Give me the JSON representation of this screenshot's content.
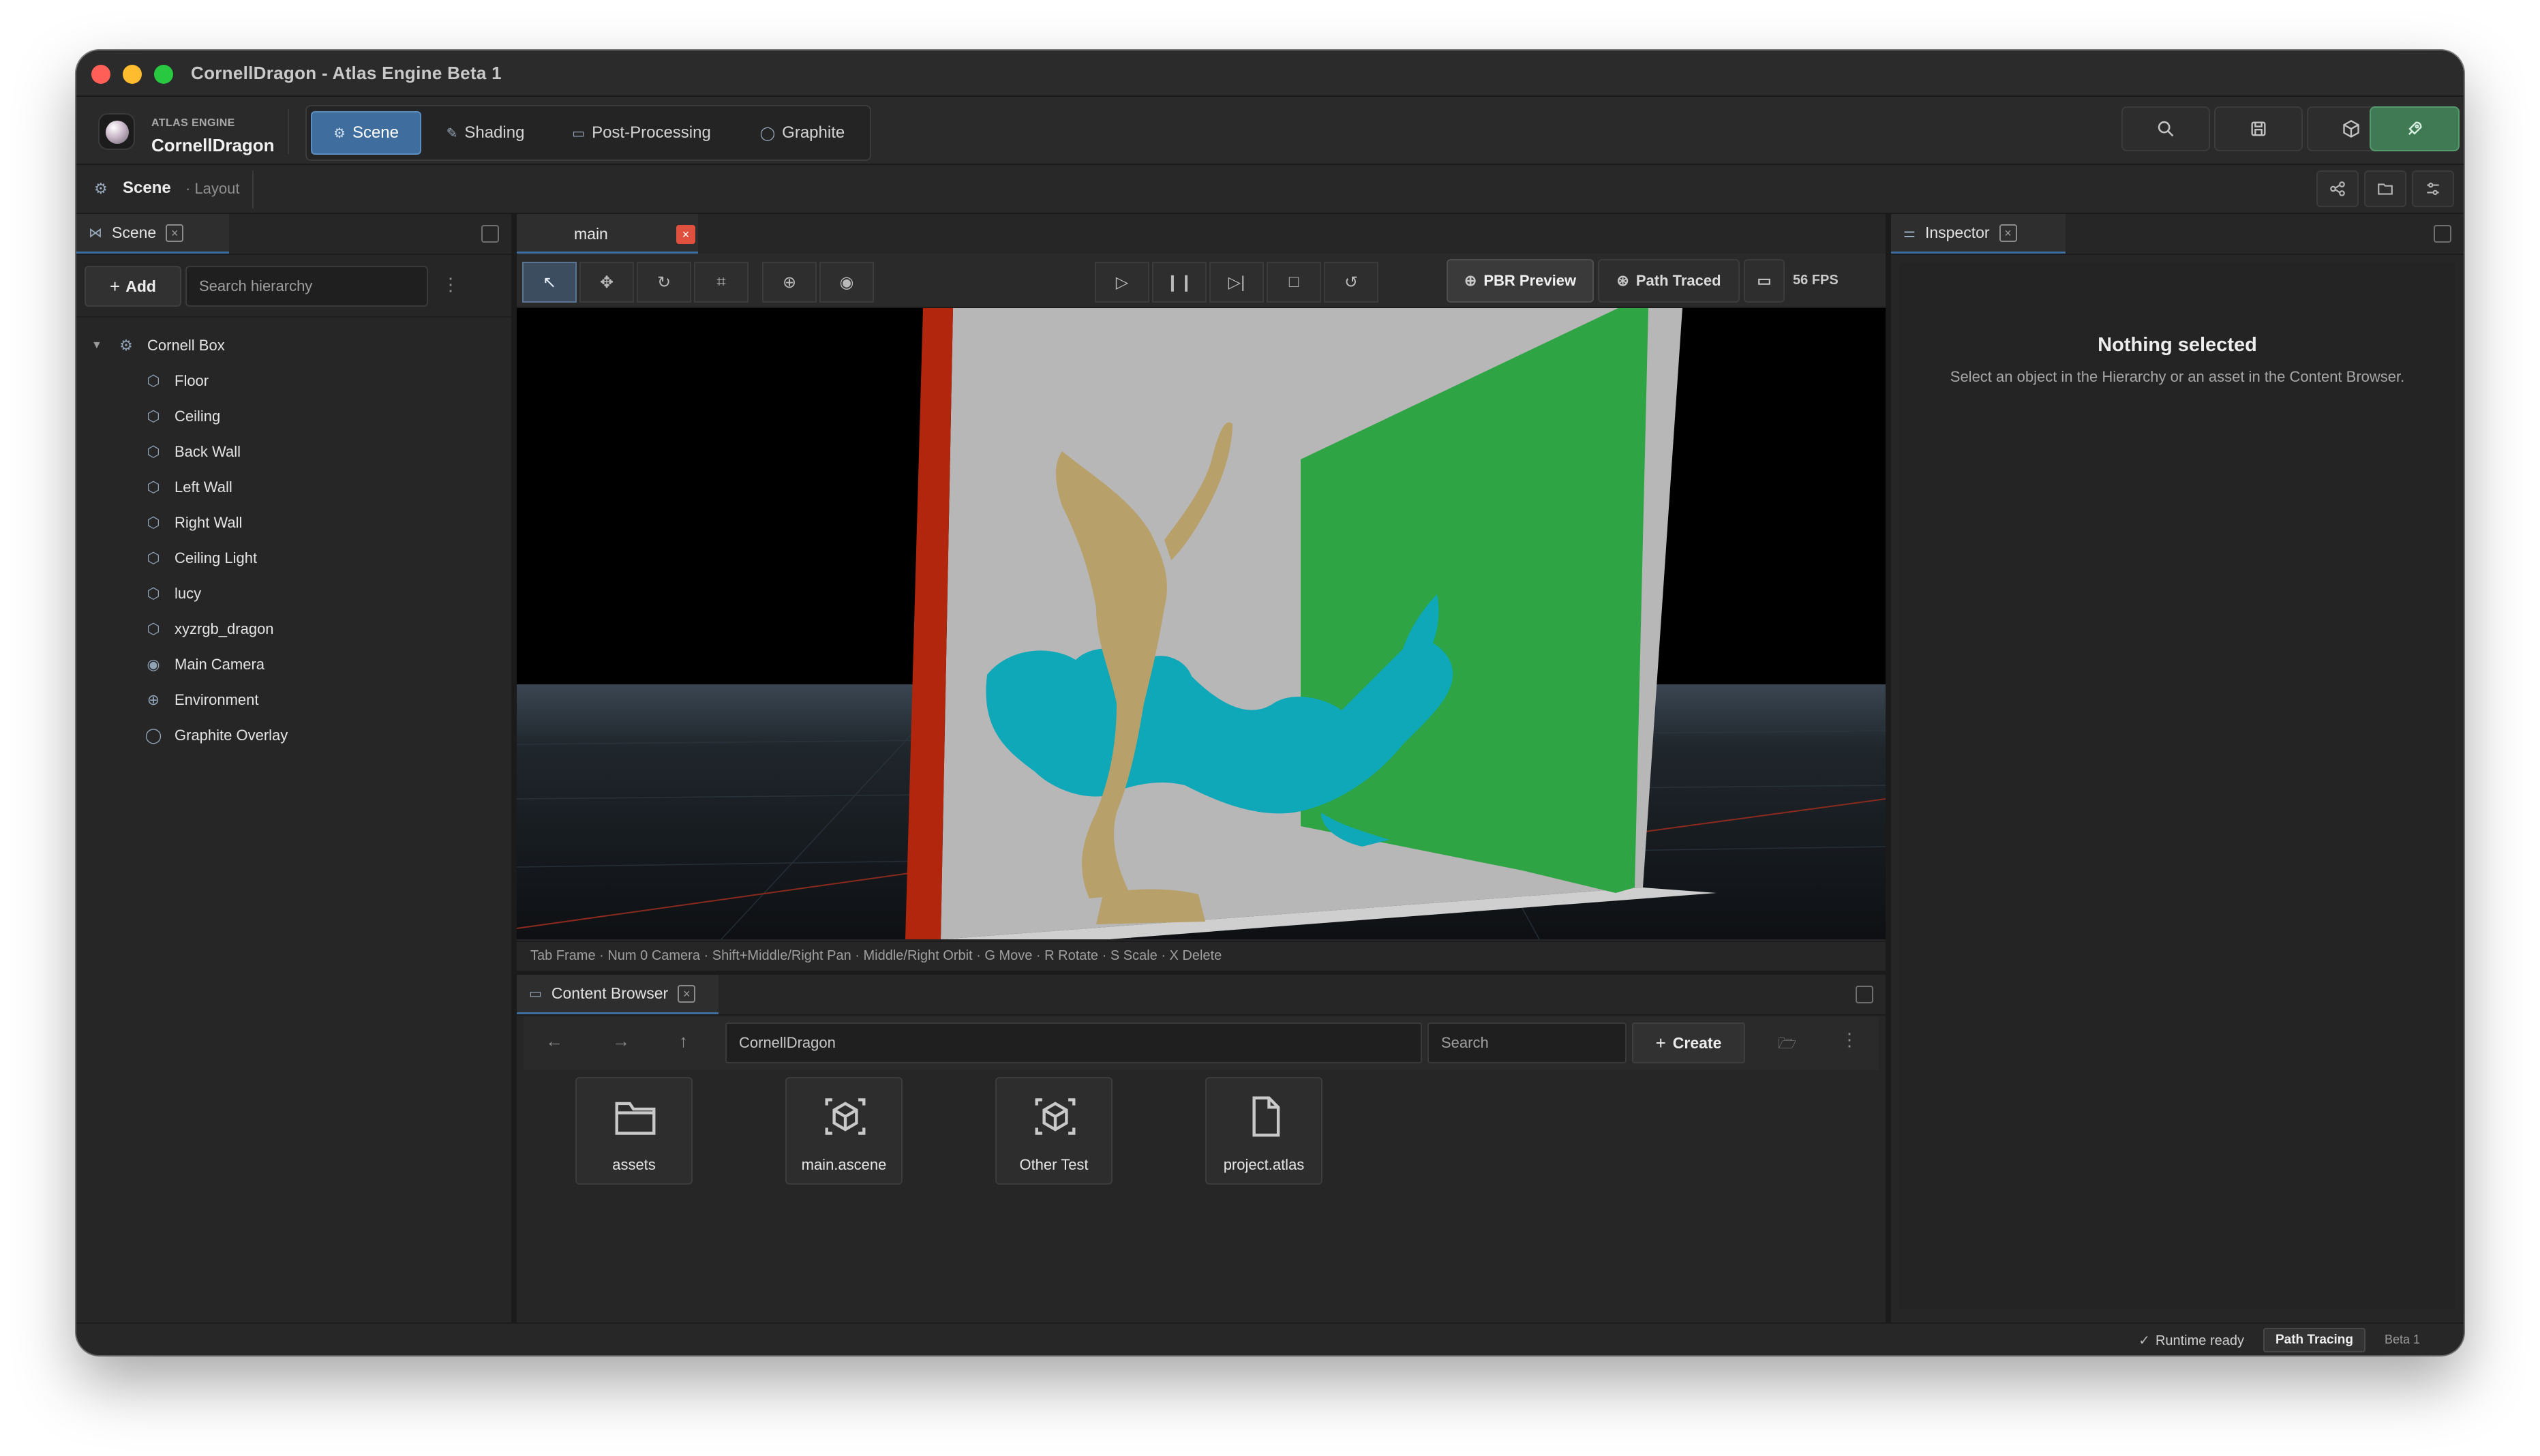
{
  "window": {
    "title": "CornellDragon - Atlas Engine Beta 1",
    "traffic_colors": [
      "#ff5f57",
      "#febc2e",
      "#28c840"
    ]
  },
  "brand": {
    "small": "ATLAS ENGINE",
    "project": "CornellDragon"
  },
  "modes": [
    {
      "label": "Scene",
      "icon": "scene-icon",
      "active": true
    },
    {
      "label": "Shading",
      "icon": "brush-icon"
    },
    {
      "label": "Post-Processing",
      "icon": "image-icon"
    },
    {
      "label": "Graphite",
      "icon": "speech-bubble-icon"
    }
  ],
  "toolbar_right": [
    "search-icon",
    "save-icon",
    "package-icon",
    "rocket-icon"
  ],
  "subbar": {
    "title": "Scene",
    "layout": "· Layout"
  },
  "hierarchy": {
    "tab": "Scene",
    "add_label": "Add",
    "search_placeholder": "Search hierarchy",
    "root": "Cornell Box",
    "items": [
      {
        "label": "Floor",
        "icon": "cube-icon"
      },
      {
        "label": "Ceiling",
        "icon": "cube-icon"
      },
      {
        "label": "Back Wall",
        "icon": "cube-icon"
      },
      {
        "label": "Left Wall",
        "icon": "cube-icon"
      },
      {
        "label": "Right Wall",
        "icon": "cube-icon"
      },
      {
        "label": "Ceiling Light",
        "icon": "cube-icon"
      },
      {
        "label": "lucy",
        "icon": "cube-icon"
      },
      {
        "label": "xyzrgb_dragon",
        "icon": "cube-icon"
      },
      {
        "label": "Main Camera",
        "icon": "camera-icon"
      },
      {
        "label": "Environment",
        "icon": "globe-icon"
      },
      {
        "label": "Graphite Overlay",
        "icon": "speech-bubble-icon"
      }
    ]
  },
  "viewport": {
    "tab": "main",
    "pbr_label": "PBR Preview",
    "path_label": "Path Traced",
    "fps": "56 FPS",
    "hint": "Tab Frame · Num 0 Camera · Shift+Middle/Right Pan · Middle/Right Orbit · G Move · R Rotate · S Scale · X Delete"
  },
  "content_browser": {
    "tab": "Content Browser",
    "path": "CornellDragon",
    "search_placeholder": "Search",
    "create_label": "Create",
    "assets": [
      {
        "label": "assets",
        "icon": "folder-icon"
      },
      {
        "label": "main.ascene",
        "icon": "scene-file-icon"
      },
      {
        "label": "Other Test",
        "icon": "scene-file-icon"
      },
      {
        "label": "project.atlas",
        "icon": "file-icon"
      }
    ]
  },
  "inspector": {
    "tab": "Inspector",
    "title": "Nothing selected",
    "subtitle": "Select an object in the Hierarchy or an asset in the Content Browser."
  },
  "status": {
    "ready": "Runtime ready",
    "mode": "Path Tracing",
    "version": "Beta 1"
  },
  "colors": {
    "accent": "#3f6e9e",
    "run_green": "#3f7a55",
    "left_wall": "#b3260e",
    "right_wall": "#2ea444",
    "lucy": "#b8a06a",
    "dragon": "#0fa8b8"
  }
}
